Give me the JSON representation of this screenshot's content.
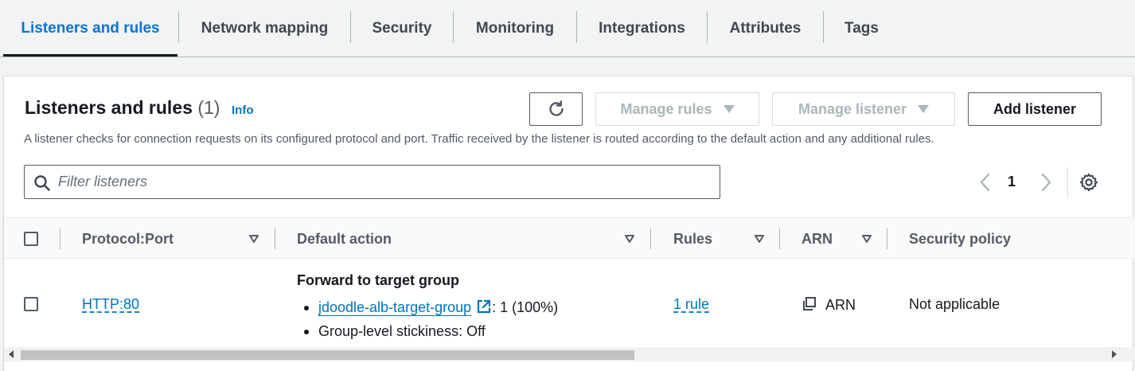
{
  "tabs": [
    {
      "label": "Listeners and rules",
      "active": true
    },
    {
      "label": "Network mapping"
    },
    {
      "label": "Security"
    },
    {
      "label": "Monitoring"
    },
    {
      "label": "Integrations"
    },
    {
      "label": "Attributes"
    },
    {
      "label": "Tags"
    }
  ],
  "header": {
    "title": "Listeners and rules",
    "count": "(1)",
    "info": "Info",
    "description": "A listener checks for connection requests on its configured protocol and port. Traffic received by the listener is routed according to the default action and any additional rules."
  },
  "actions": {
    "refresh_icon": "refresh-icon",
    "manage_rules": "Manage rules",
    "manage_listener": "Manage listener",
    "add_listener": "Add listener"
  },
  "filter": {
    "placeholder": "Filter listeners"
  },
  "pagination": {
    "current_page": "1"
  },
  "table": {
    "columns": [
      "Protocol:Port",
      "Default action",
      "Rules",
      "ARN",
      "Security policy"
    ],
    "rows": [
      {
        "protocol_port": "HTTP:80",
        "default_action_title": "Forward to target group",
        "target_group": "jdoodle-alb-target-group",
        "target_weight": ": 1 (100%)",
        "stickiness": "Group-level stickiness: Off",
        "rules": "1 rule",
        "arn": "ARN",
        "security_policy": "Not applicable"
      }
    ]
  },
  "colors": {
    "accent": "#0972d3",
    "link": "#0073bb",
    "text": "#16191f",
    "muted": "#545b64",
    "disabled": "#aab7b8"
  }
}
